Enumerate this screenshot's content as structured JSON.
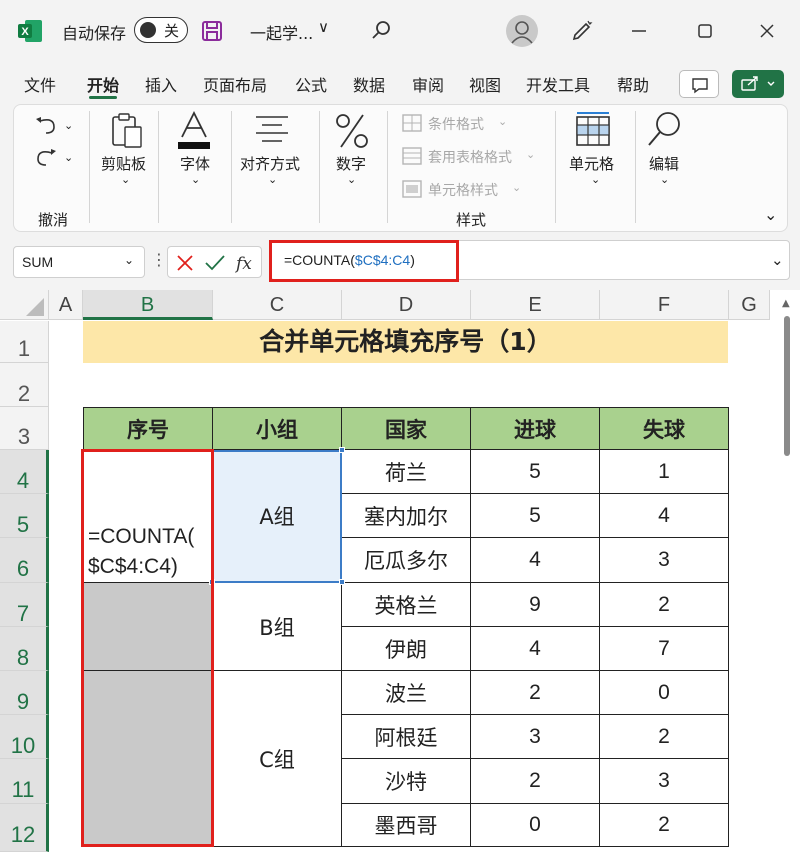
{
  "titlebar": {
    "app_logo": "X",
    "autosave_label": "自动保存",
    "autosave_state": "关",
    "filename": "一起学...",
    "filename_chevron": "∨"
  },
  "tabs": [
    {
      "label": "文件"
    },
    {
      "label": "开始"
    },
    {
      "label": "插入"
    },
    {
      "label": "页面布局"
    },
    {
      "label": "公式"
    },
    {
      "label": "数据"
    },
    {
      "label": "审阅"
    },
    {
      "label": "视图"
    },
    {
      "label": "开发工具"
    },
    {
      "label": "帮助"
    }
  ],
  "ribbon": {
    "undo_group": "撤消",
    "clipboard": "剪贴板",
    "font": "字体",
    "align": "对齐方式",
    "number": "数字",
    "cond_format": "条件格式",
    "table_format": "套用表格格式",
    "cell_style": "单元格样式",
    "style_group": "样式",
    "cells": "单元格",
    "editing": "编辑"
  },
  "formula_bar": {
    "name_box": "SUM",
    "formula_prefix": "=COUNTA(",
    "formula_ref": "$C$4:C4",
    "formula_suffix": ")"
  },
  "columns": [
    "A",
    "B",
    "C",
    "D",
    "E",
    "F",
    "G"
  ],
  "rows": [
    "1",
    "2",
    "3",
    "4",
    "5",
    "6",
    "7",
    "8",
    "9",
    "10",
    "11",
    "12"
  ],
  "sheet": {
    "title": "合并单元格填充序号（1）",
    "headers": [
      "序号",
      "小组",
      "国家",
      "进球",
      "失球"
    ],
    "groups": [
      "A组",
      "B组",
      "C组"
    ],
    "b4_formula_line1": "=COUNTA(",
    "b4_formula_line2": "$C$4:C4)",
    "data": [
      {
        "country": "荷兰",
        "goals": "5",
        "conceded": "1"
      },
      {
        "country": "塞内加尔",
        "goals": "5",
        "conceded": "4"
      },
      {
        "country": "厄瓜多尔",
        "goals": "4",
        "conceded": "3"
      },
      {
        "country": "英格兰",
        "goals": "9",
        "conceded": "2"
      },
      {
        "country": "伊朗",
        "goals": "4",
        "conceded": "7"
      },
      {
        "country": "波兰",
        "goals": "2",
        "conceded": "0"
      },
      {
        "country": "阿根廷",
        "goals": "3",
        "conceded": "2"
      },
      {
        "country": "沙特",
        "goals": "2",
        "conceded": "3"
      },
      {
        "country": "墨西哥",
        "goals": "0",
        "conceded": "2"
      }
    ]
  },
  "colors": {
    "accent": "#217346",
    "header_fill": "#a9d18e",
    "title_fill": "#fde7a8",
    "highlight_red": "#e0201c",
    "ref_blue": "#1f6fc0"
  }
}
